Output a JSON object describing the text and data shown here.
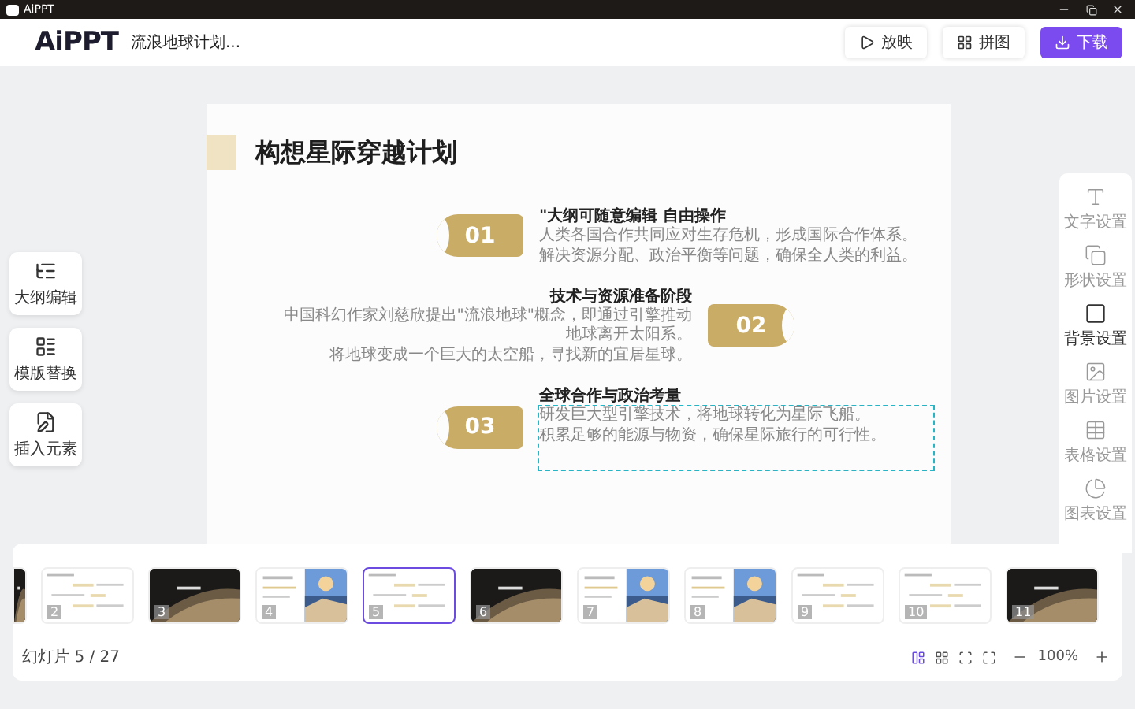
{
  "window": {
    "title": "AiPPT"
  },
  "header": {
    "logo": "AiPPT",
    "document_title": "流浪地球计划...",
    "buttons": [
      {
        "label": "放映",
        "kind": "plain"
      },
      {
        "label": "拼图",
        "kind": "plain"
      },
      {
        "label": "下载",
        "kind": "primary"
      }
    ]
  },
  "left_tools": [
    {
      "label": "大纲编辑"
    },
    {
      "label": "模版替换"
    },
    {
      "label": "插入元素"
    }
  ],
  "slide": {
    "title": "构想星际穿越计划",
    "items": [
      {
        "number": "01",
        "kind": "text_right",
        "selected": false,
        "heading": "\"大纲可随意编辑 自由操作",
        "body": [
          "人类各国合作共同应对生存危机，形成国际合作体系。",
          "解决资源分配、政治平衡等问题，确保全人类的利益。"
        ]
      },
      {
        "number": "02",
        "kind": "text_left",
        "selected": false,
        "heading": "技术与资源准备阶段",
        "body": [
          "中国科幻作家刘慈欣提出\"流浪地球\"概念，即通过引擎推动地球离开太阳系。",
          "将地球变成一个巨大的太空船，寻找新的宜居星球。"
        ]
      },
      {
        "number": "03",
        "kind": "text_right",
        "selected": true,
        "heading": "全球合作与政治考量",
        "body": [
          "研发巨大型引擎技术，将地球转化为星际飞船。",
          "积累足够的能源与物资，确保星际旅行的可行性。"
        ]
      }
    ]
  },
  "right_panel": [
    {
      "label": "文字设置",
      "selected": false
    },
    {
      "label": "形状设置",
      "selected": false
    },
    {
      "label": "背景设置",
      "selected": true
    },
    {
      "label": "图片设置",
      "selected": false
    },
    {
      "label": "表格设置",
      "selected": false
    },
    {
      "label": "图表设置",
      "selected": false
    }
  ],
  "thumbnails": [
    {
      "kind": "dark",
      "clipped": true,
      "selected": false
    },
    {
      "number": "2",
      "kind": "light",
      "selected": false
    },
    {
      "number": "3",
      "kind": "dark",
      "selected": false
    },
    {
      "number": "4",
      "selected": false
    },
    {
      "number": "5",
      "kind": "light",
      "selected": true
    },
    {
      "number": "6",
      "kind": "dark",
      "selected": false
    },
    {
      "number": "7",
      "selected": false
    },
    {
      "number": "8",
      "selected": false
    },
    {
      "number": "9",
      "kind": "light",
      "selected": false
    },
    {
      "number": "10",
      "kind": "light",
      "selected": false
    },
    {
      "number": "11",
      "kind": "dark",
      "selected": false
    }
  ],
  "status": {
    "slide_label": "幻灯片",
    "slide_count": "5 / 27",
    "view_buttons": [
      {
        "selected": true
      },
      {
        "selected": false
      },
      {
        "selected": false
      },
      {
        "selected": false
      }
    ],
    "zoom": "100%"
  }
}
